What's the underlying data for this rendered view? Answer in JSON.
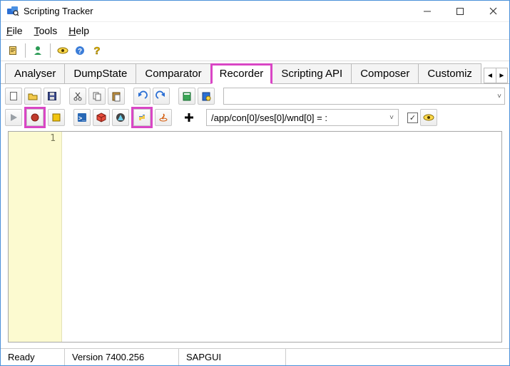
{
  "window": {
    "title": "Scripting Tracker"
  },
  "menu": {
    "file": "File",
    "tools": "Tools",
    "help": "Help"
  },
  "topToolbar": {
    "icons": [
      "doc",
      "user",
      "eye",
      "help-round",
      "help-question"
    ]
  },
  "tabs": {
    "items": [
      "Analyser",
      "DumpState",
      "Comparator",
      "Recorder",
      "Scripting API",
      "Composer",
      "Customiz"
    ],
    "activeIndex": 3
  },
  "recorderToolbar": {
    "row1Icons": [
      "new",
      "open",
      "save",
      "cut",
      "copy",
      "paste",
      "undo",
      "redo",
      "book-green",
      "book-blue"
    ],
    "row2Icons": [
      "play",
      "record",
      "stop-yellow",
      "powershell",
      "cube",
      "autoit",
      "python",
      "java",
      "plus"
    ],
    "pathValue": "/app/con[0]/ses[0]/wnd[0] = :",
    "checkbox": true
  },
  "editor": {
    "lineNumbers": [
      "1"
    ]
  },
  "status": {
    "ready": "Ready",
    "version": "Version 7400.256",
    "gui": "SAPGUI"
  }
}
